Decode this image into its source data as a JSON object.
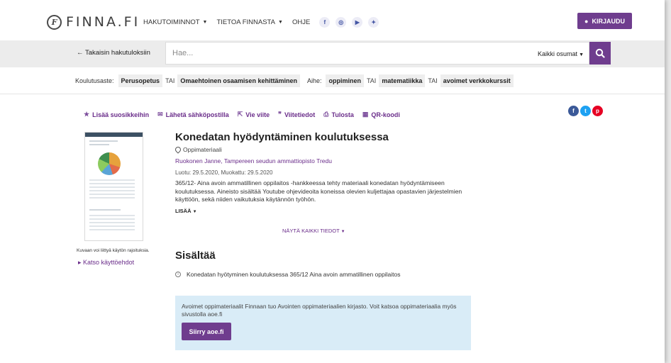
{
  "header": {
    "logo_text": "FINNA.FI",
    "logo_mark": "F",
    "nav": [
      {
        "label": "HAKUTOIMINNOT",
        "has_caret": true
      },
      {
        "label": "TIETOA FINNASTA",
        "has_caret": true
      },
      {
        "label": "OHJE",
        "has_caret": false
      }
    ],
    "social": [
      {
        "name": "facebook-icon",
        "glyph": "f"
      },
      {
        "name": "instagram-icon",
        "glyph": "◎"
      },
      {
        "name": "youtube-icon",
        "glyph": "▶"
      },
      {
        "name": "twitter-icon",
        "glyph": "✦"
      }
    ],
    "login_label": "KIRJAUDU"
  },
  "search": {
    "back_label": "Takaisin hakutuloksiin",
    "placeholder": "Hae...",
    "scope": "Kaikki osumat"
  },
  "filters": {
    "level_label": "Koulutusaste:",
    "level": [
      "Perusopetus",
      "Omaehtoinen osaamisen kehittäminen"
    ],
    "topic_label": "Aihe:",
    "topic": [
      "oppiminen",
      "matematiikka",
      "avoimet verkkokurssit"
    ],
    "or": "TAI"
  },
  "actions": [
    {
      "icon": "star-icon",
      "glyph": "★",
      "label": "Lisää suosikkeihin"
    },
    {
      "icon": "email-icon",
      "glyph": "✉",
      "label": "Lähetä sähköpostilla"
    },
    {
      "icon": "export-icon",
      "glyph": "⇱",
      "label": "Vie viite"
    },
    {
      "icon": "quote-icon",
      "glyph": "❞",
      "label": "Viitetiedot"
    },
    {
      "icon": "print-icon",
      "glyph": "⎙",
      "label": "Tulosta"
    },
    {
      "icon": "qr-icon",
      "glyph": "▦",
      "label": "QR-koodi"
    }
  ],
  "share": [
    {
      "name": "share-facebook-icon",
      "glyph": "f",
      "color": "#3b5998"
    },
    {
      "name": "share-twitter-icon",
      "glyph": "t",
      "color": "#1da1f2"
    },
    {
      "name": "share-pinterest-icon",
      "glyph": "p",
      "color": "#e60023"
    }
  ],
  "record": {
    "image_note": "Kuvaan voi liittyä käytön rajoituksia.",
    "terms_label": "Katso käyttöehdot",
    "title": "Konedatan hyödyntäminen koulutuksessa",
    "format": "Oppimateriaali",
    "authors": "Ruokonen Janne, Tampereen seudun ammattiopisto Tredu",
    "dates": "Luotu: 29.5.2020, Muokattu: 29.5.2020",
    "description": "365/12- Aina avoin ammatillinen oppilaitos -hankkeessa tehty materiaali konedatan hyödyntämiseen koulutuksessa. Aineisto sisältää Youtube ohjevideoita koneissa olevien kuljettajaa opastavien järjestelmien käyttöön, sekä niiden vaikutuksia käytännön työhön.",
    "more_label": "LISÄÄ",
    "show_all_label": "NÄYTÄ KAIKKI TIEDOT"
  },
  "contents": {
    "heading": "Sisältää",
    "item": "Konedatan hyötyminen koulutuksessa 365/12 Aina avoin ammatillinen oppilaitos"
  },
  "info": {
    "text": "Avoimet oppimateriaalit Finnaan tuo Avointen oppimateriaalien kirjasto. Voit katsoa oppimateriaalia myös sivustolla aoe.fi",
    "button_label": "Siirry aoe.fi"
  },
  "colors": {
    "accent": "#6f3d8e",
    "info_bg": "#d9ecf7"
  }
}
